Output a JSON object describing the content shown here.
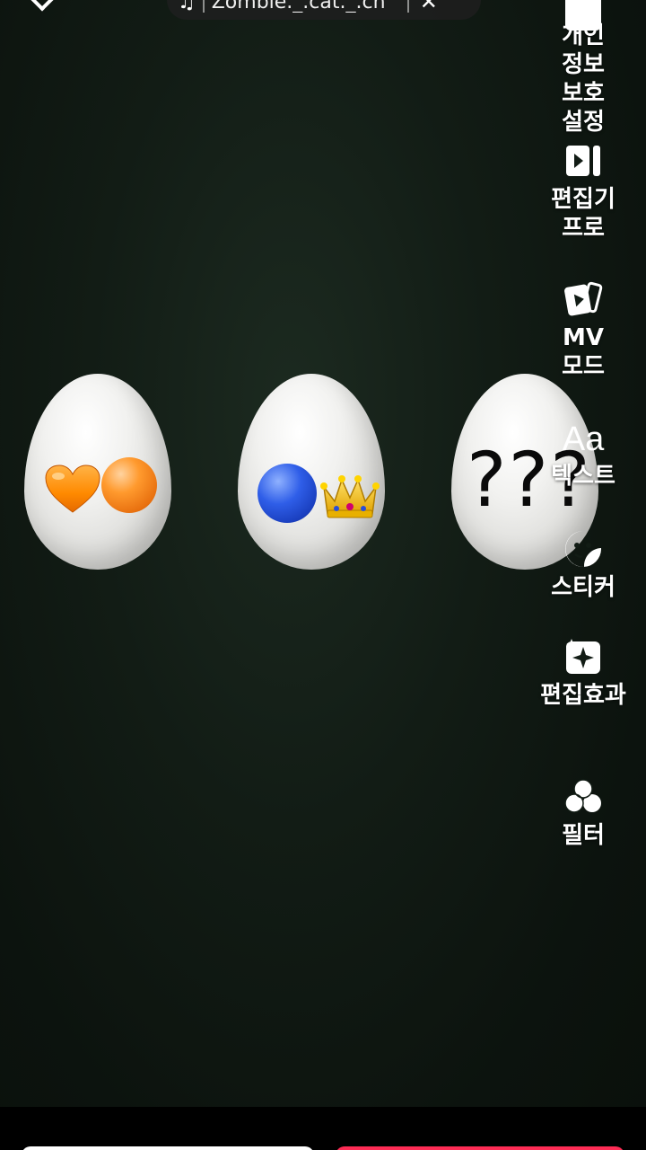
{
  "sound": {
    "title": "Zombie._.cat._.ch",
    "note_icon": "music-note-icon",
    "close_icon": "close-icon"
  },
  "eggs": [
    {
      "contents": [
        "orange-heart",
        "orange-ball"
      ]
    },
    {
      "contents": [
        "blue-ball",
        "crown"
      ]
    },
    {
      "contents": [
        "???"
      ],
      "text": "???"
    }
  ],
  "toolbar": {
    "items": [
      {
        "label": "개인 정보 보호 설정",
        "icon": "privacy-icon"
      },
      {
        "label": "편집기 프로",
        "icon": "editor-pro-icon"
      },
      {
        "label": "MV 모드",
        "icon": "mv-mode-icon"
      },
      {
        "label": "텍스트",
        "icon": "text-icon",
        "glyph": "Aa"
      },
      {
        "label": "스티커",
        "icon": "sticker-icon"
      },
      {
        "label": "편집효과",
        "icon": "effects-icon"
      },
      {
        "label": "필터",
        "icon": "filter-icon"
      }
    ],
    "expand_icon": "chevron-down-icon"
  },
  "colors": {
    "background": "#121c15",
    "accent": "#fe2c55"
  }
}
